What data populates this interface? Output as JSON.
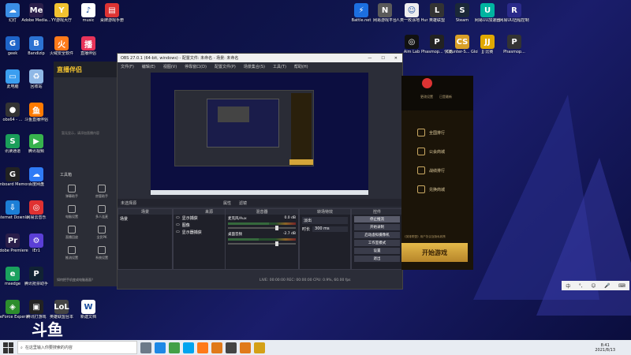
{
  "desktop": {
    "left_icons": [
      {
        "label": "幻灯",
        "color": "#3a8ee6",
        "glyph": "☁"
      },
      {
        "label": "Adobe Media...",
        "color": "#2a1e4a",
        "glyph": "Me"
      },
      {
        "label": "YY游戏大厅",
        "color": "#f2c230",
        "glyph": "Y"
      },
      {
        "label": "music",
        "color": "#ffffff",
        "glyph": "♪"
      },
      {
        "label": "桌牌游戏手册",
        "color": "#d33",
        "glyph": "▤"
      },
      {
        "label": "geek",
        "color": "#1e64c8",
        "glyph": "G"
      },
      {
        "label": "Bandizip",
        "color": "#2c73d2",
        "glyph": "B"
      },
      {
        "label": "火绒安全软件",
        "color": "#ff7a1a",
        "glyph": "火"
      },
      {
        "label": "直播伴侣",
        "color": "#e8345a",
        "glyph": "播"
      },
      {
        "label": "此电脑",
        "color": "#3b9ef0",
        "glyph": "▭"
      },
      {
        "label": "回收站",
        "color": "#8fb8e6",
        "glyph": "♻"
      },
      {
        "label": "obs64 - ...",
        "color": "#333",
        "glyph": "●"
      },
      {
        "label": "斗鱼直播伴侣",
        "color": "#ff7a00",
        "glyph": "鱼"
      },
      {
        "label": "讯读通道",
        "color": "#1a9e5a",
        "glyph": "S"
      },
      {
        "label": "腾讯视频",
        "color": "#37b24d",
        "glyph": "▶"
      },
      {
        "label": "Onboard Memory...",
        "color": "#222",
        "glyph": "G"
      },
      {
        "label": "百度网盘",
        "color": "#2f7bf6",
        "glyph": "☁"
      },
      {
        "label": "Internet Downlo...",
        "color": "#1c7ed6",
        "glyph": "⇩"
      },
      {
        "label": "网易云音乐",
        "color": "#e03131",
        "glyph": "◎"
      },
      {
        "label": "Adobe Premiere...",
        "color": "#2a1e4a",
        "glyph": "Pr"
      },
      {
        "label": "IEr1",
        "color": "#5b3fd6",
        "glyph": "⚙"
      },
      {
        "label": "msedge",
        "color": "#1aa15e",
        "glyph": "e"
      },
      {
        "label": "腾讯抢票助手",
        "color": "#123",
        "glyph": "P"
      },
      {
        "label": "GeForce Experience",
        "color": "#2d8d2d",
        "glyph": "◈"
      },
      {
        "label": "腾讯打游戏",
        "color": "#222",
        "glyph": "▣"
      },
      {
        "label": "英雄联盟台本",
        "color": "#444",
        "glyph": "LoL"
      },
      {
        "label": "新建文档",
        "color": "#fff",
        "glyph": "W"
      }
    ],
    "right_icons": [
      {
        "label": "Battle.net",
        "color": "#1c6fe0",
        "glyph": "⚡"
      },
      {
        "label": "网易游戏平台",
        "color": "#5a5a5a",
        "glyph": "N"
      },
      {
        "label": "人类一败涂地 Human Fa...",
        "color": "#eee",
        "glyph": "☺"
      },
      {
        "label": "英雄联盟",
        "color": "#333",
        "glyph": "L"
      },
      {
        "label": "Steam",
        "color": "#1b2838",
        "glyph": "S"
      },
      {
        "label": "网易UU加速器",
        "color": "#00b4a0",
        "glyph": "U"
      },
      {
        "label": "网易UU远程控制",
        "color": "#2a2a8a",
        "glyph": "R"
      },
      {
        "label": "Aim Lab",
        "color": "#111",
        "glyph": "◎"
      },
      {
        "label": "Phasmop... 快捷方式",
        "color": "#222",
        "glyph": "P"
      },
      {
        "label": "Counter-S... Global Off...",
        "color": "#d9a028",
        "glyph": "CS"
      },
      {
        "label": "JJ 比赛",
        "color": "#e0a800",
        "glyph": "JJ"
      },
      {
        "label": "Phasmop...",
        "color": "#333",
        "glyph": "P"
      }
    ]
  },
  "zhibo": {
    "logo": "直播伴侣",
    "hint": "暂无显示，请添加直播内容",
    "tools_title": "工具箱",
    "tools": [
      "弹幕助手",
      "房管助手",
      "电脑设置",
      "多人连麦",
      "直播回放",
      "全民PK",
      "推流设置",
      "系统设置"
    ],
    "footer": "如何把手机变成电脑画面？"
  },
  "obs": {
    "title": "OBS 27.0.1 (64-bit, windows) - 配置文件: 未命名 - 场景: 未命名",
    "menus": [
      "文件(F)",
      "编辑(E)",
      "视图(V)",
      "停靠窗口(D)",
      "配置文件(P)",
      "场景集合(S)",
      "工具(T)",
      "帮助(H)"
    ],
    "no_source": "未选择源",
    "props_btn": "属性",
    "filter_btn": "滤镜",
    "docks": {
      "scenes": {
        "title": "场景",
        "items": [
          "场景"
        ]
      },
      "sources": {
        "title": "来源",
        "items": [
          "显示捕获",
          "图像",
          "显示器捕获"
        ]
      },
      "mixer": {
        "title": "混音器",
        "tracks": [
          {
            "name": "麦克风/Aux",
            "db": "0.0 dB",
            "level": 0.6
          },
          {
            "name": "桌面音频",
            "db": "-2.7 dB",
            "level": 0.45
          }
        ]
      },
      "transitions": {
        "title": "转场特效",
        "type": "淡出",
        "duration_label": "时长",
        "duration": "300 ms"
      },
      "controls": {
        "title": "控件",
        "buttons": [
          "停止推流",
          "开始录制",
          "启动虚拟摄像机",
          "工作室模式",
          "设置",
          "退出"
        ]
      }
    },
    "status": "LIVE: 00:00:00  REC: 00:00:00  CPU: 0.9%, 60.00 fps"
  },
  "game": {
    "items": [
      "全国排行",
      "公会商城",
      "战绩排行",
      "兑换商城"
    ],
    "notice": "《英雄联盟》用户协议及隐私政策",
    "start": "开始游戏",
    "top_links": [
      "更改设置",
      "已是最新"
    ]
  },
  "taskbar": {
    "search_placeholder": "在这里输入你要搜索的内容",
    "time": "8:41",
    "date": "2021/8/13",
    "pinned_colors": [
      "#6c7a89",
      "#1e88e5",
      "#43a047",
      "#00a4ef",
      "#ff7a1a",
      "#e07a1a",
      "#444",
      "#e07a1a",
      "#d4a017"
    ]
  },
  "watermark": "斗鱼"
}
